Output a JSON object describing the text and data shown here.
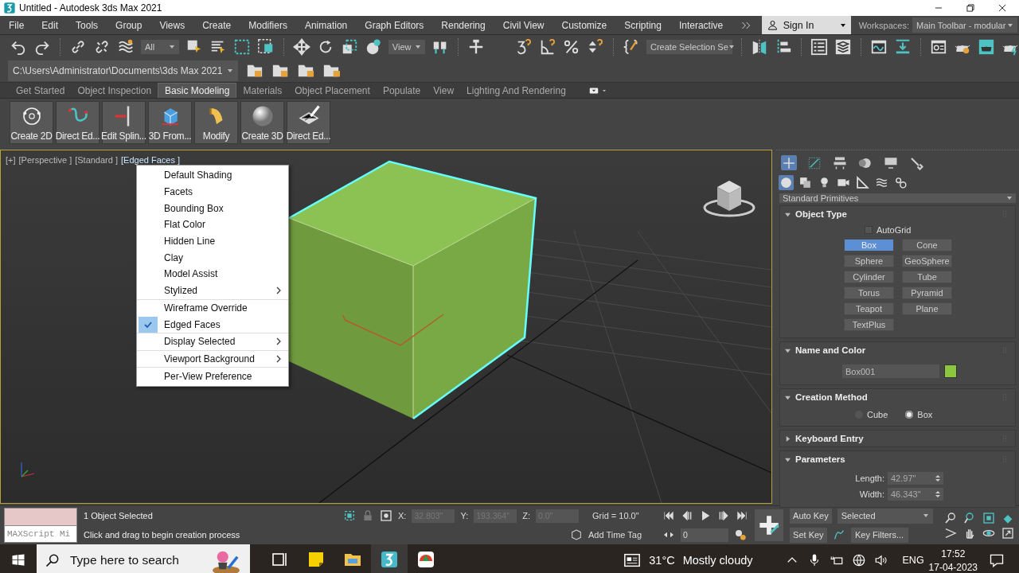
{
  "window": {
    "title": "Untitled - Autodesk 3ds Max 2021"
  },
  "menu_bar": {
    "items": [
      "File",
      "Edit",
      "Tools",
      "Group",
      "Views",
      "Create",
      "Modifiers",
      "Animation",
      "Graph Editors",
      "Rendering",
      "Civil View",
      "Customize",
      "Scripting",
      "Interactive"
    ],
    "sign_in": "Sign In",
    "workspaces_label": "Workspaces:",
    "workspace": "Main Toolbar - modular"
  },
  "main_toolbar": {
    "selection_filter": "All",
    "reference_coordinate_system": "View",
    "named_selection_set": "Create Selection Se"
  },
  "project_path": "C:\\Users\\Administrator\\Documents\\3ds Max 2021",
  "ribbon": {
    "tabs": [
      {
        "label": "Get Started",
        "selected": false
      },
      {
        "label": "Object Inspection",
        "selected": false
      },
      {
        "label": "Basic Modeling",
        "selected": true
      },
      {
        "label": "Materials",
        "selected": false
      },
      {
        "label": "Object Placement",
        "selected": false
      },
      {
        "label": "Populate",
        "selected": false
      },
      {
        "label": "View",
        "selected": false
      },
      {
        "label": "Lighting And Rendering",
        "selected": false
      }
    ],
    "buttons": [
      "Create 2D",
      "Direct Ed...",
      "Edit Splin...",
      "3D From...",
      "Modify",
      "Create 3D",
      "Direct Ed..."
    ]
  },
  "viewport": {
    "labels": [
      {
        "text": "[+]",
        "selected": false
      },
      {
        "text": "[Perspective ]",
        "selected": false
      },
      {
        "text": "[Standard ]",
        "selected": false
      },
      {
        "text": "[Edged Faces ]",
        "selected": true
      }
    ],
    "menu": {
      "groups": [
        {
          "items": [
            {
              "label": "Default Shading",
              "checked": false,
              "submenu": false
            },
            {
              "label": "Facets",
              "checked": false,
              "submenu": false
            },
            {
              "label": "Bounding Box",
              "checked": false,
              "submenu": false
            },
            {
              "label": "Flat Color",
              "checked": false,
              "submenu": false
            },
            {
              "label": "Hidden Line",
              "checked": false,
              "submenu": false
            },
            {
              "label": "Clay",
              "checked": false,
              "submenu": false
            },
            {
              "label": "Model Assist",
              "checked": false,
              "submenu": false
            },
            {
              "label": "Stylized",
              "checked": false,
              "submenu": true
            }
          ]
        },
        {
          "items": [
            {
              "label": "Wireframe Override",
              "checked": false,
              "submenu": false
            },
            {
              "label": "Edged Faces",
              "checked": true,
              "submenu": false
            }
          ]
        },
        {
          "items": [
            {
              "label": "Display Selected",
              "checked": false,
              "submenu": true
            }
          ]
        },
        {
          "items": [
            {
              "label": "Viewport Background",
              "checked": false,
              "submenu": true
            }
          ]
        },
        {
          "items": [
            {
              "label": "Per-View Preference",
              "checked": false,
              "submenu": false
            }
          ]
        }
      ]
    }
  },
  "command_panel": {
    "tabs": [
      {
        "selected": true
      },
      {
        "selected": false
      },
      {
        "selected": false
      },
      {
        "selected": false
      },
      {
        "selected": false
      },
      {
        "selected": false
      }
    ],
    "categories": [
      {
        "selected": true
      },
      {
        "selected": false
      },
      {
        "selected": false
      },
      {
        "selected": false
      },
      {
        "selected": false
      },
      {
        "selected": false
      },
      {
        "selected": false
      }
    ],
    "category_dropdown": "Standard Primitives",
    "rollouts": [
      {
        "kind": "object_type",
        "title": "Object Type",
        "expanded": true,
        "autogrid": {
          "label": "AutoGrid",
          "checked": false
        },
        "buttons": [
          {
            "label": "Box",
            "selected": true
          },
          {
            "label": "Cone",
            "selected": false
          },
          {
            "label": "Sphere",
            "selected": false
          },
          {
            "label": "GeoSphere",
            "selected": false
          },
          {
            "label": "Cylinder",
            "selected": false
          },
          {
            "label": "Tube",
            "selected": false
          },
          {
            "label": "Torus",
            "selected": false
          },
          {
            "label": "Pyramid",
            "selected": false
          },
          {
            "label": "Teapot",
            "selected": false
          },
          {
            "label": "Plane",
            "selected": false
          },
          {
            "label": "TextPlus",
            "selected": false
          }
        ]
      },
      {
        "kind": "name_color",
        "title": "Name and Color",
        "expanded": true,
        "name": "Box001",
        "color": "#8cc63f"
      },
      {
        "kind": "creation_method",
        "title": "Creation Method",
        "expanded": true,
        "options": [
          {
            "label": "Cube",
            "selected": false
          },
          {
            "label": "Box",
            "selected": true
          }
        ]
      },
      {
        "kind": "keyboard_entry",
        "title": "Keyboard Entry",
        "expanded": false
      },
      {
        "kind": "parameters",
        "title": "Parameters",
        "expanded": true,
        "fields": [
          {
            "label": "Length:",
            "value": "42.97\""
          },
          {
            "label": "Width:",
            "value": "46.343\""
          }
        ]
      }
    ]
  },
  "status_bar": {
    "listener_placeholder": "MAXScript Mi",
    "selection": "1 Object Selected",
    "prompt": "Click and drag to begin creation process",
    "coords": [
      {
        "label": "X:",
        "value": "32.803\""
      },
      {
        "label": "Y:",
        "value": "193.364\""
      },
      {
        "label": "Z:",
        "value": "0.0\""
      }
    ],
    "grid": "Grid = 10.0\"",
    "time_tag": "Add Time Tag",
    "frame": "0",
    "auto_key": "Auto Key",
    "set_key": "Set Key",
    "key_mode": "Selected",
    "key_filters": "Key Filters..."
  },
  "taskbar": {
    "search_placeholder": "Type here to search",
    "apps": [
      {
        "selected": false
      },
      {
        "selected": false
      },
      {
        "selected": false
      },
      {
        "selected": true
      },
      {
        "selected": false
      }
    ],
    "temperature": "31°C",
    "weather": "Mostly cloudy",
    "language": "ENG",
    "time": "17:52",
    "date": "17-04-2023"
  }
}
